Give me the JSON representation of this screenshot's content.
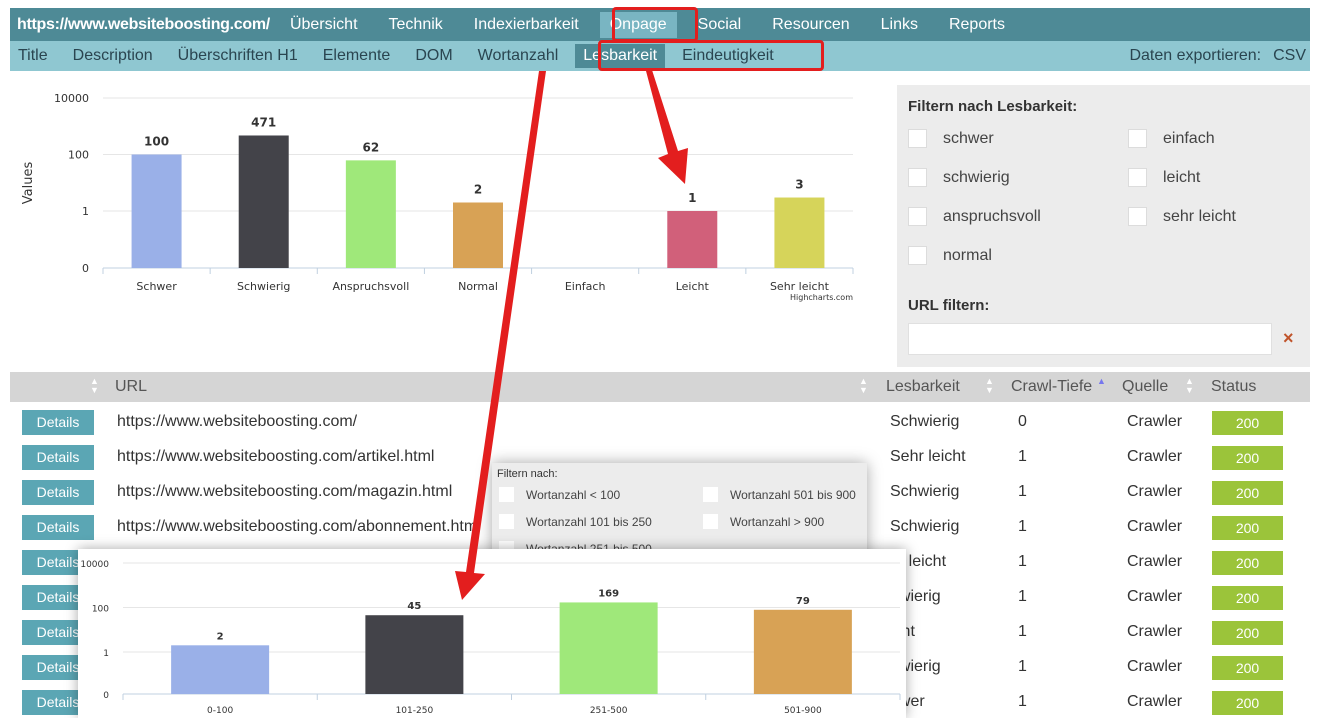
{
  "topnav": {
    "site": "https://www.websiteboosting.com/",
    "items": [
      "Übersicht",
      "Technik",
      "Indexierbarkeit",
      "Onpage",
      "Social",
      "Resourcen",
      "Links",
      "Reports"
    ],
    "active": "Onpage"
  },
  "subnav": {
    "items": [
      "Title",
      "Description",
      "Überschriften H1",
      "Elemente",
      "DOM",
      "Wortanzahl",
      "Lesbarkeit",
      "Eindeutigkeit"
    ],
    "active": "Lesbarkeit",
    "export_label": "Daten exportieren:",
    "export_csv": "CSV"
  },
  "filter": {
    "title": "Filtern nach Lesbarkeit:",
    "options": [
      "schwer",
      "einfach",
      "schwierig",
      "leicht",
      "anspruchsvoll",
      "sehr leicht",
      "normal"
    ],
    "url_title": "URL filtern:",
    "url_value": "",
    "clear_icon": "×"
  },
  "table": {
    "columns": [
      "URL",
      "Lesbarkeit",
      "Crawl-Tiefe",
      "Quelle",
      "Status"
    ],
    "details_label": "Details",
    "rows": [
      {
        "url": "https://www.websiteboosting.com/",
        "lesbarkeit": "Schwierig",
        "tiefe": "0",
        "quelle": "Crawler",
        "status": "200"
      },
      {
        "url": "https://www.websiteboosting.com/artikel.html",
        "lesbarkeit": "Sehr leicht",
        "tiefe": "1",
        "quelle": "Crawler",
        "status": "200"
      },
      {
        "url": "https://www.websiteboosting.com/magazin.html",
        "lesbarkeit": "Schwierig",
        "tiefe": "1",
        "quelle": "Crawler",
        "status": "200"
      },
      {
        "url": "https://www.websiteboosting.com/abonnement.htm",
        "lesbarkeit": "Schwierig",
        "tiefe": "1",
        "quelle": "Crawler",
        "status": "200"
      },
      {
        "url": "",
        "lesbarkeit": "hr leicht",
        "tiefe": "1",
        "quelle": "Crawler",
        "status": "200"
      },
      {
        "url": "",
        "lesbarkeit": "hwierig",
        "tiefe": "1",
        "quelle": "Crawler",
        "status": "200"
      },
      {
        "url": "",
        "lesbarkeit": "icht",
        "tiefe": "1",
        "quelle": "Crawler",
        "status": "200"
      },
      {
        "url": "",
        "lesbarkeit": "hwierig",
        "tiefe": "1",
        "quelle": "Crawler",
        "status": "200"
      },
      {
        "url": "",
        "lesbarkeit": "hwer",
        "tiefe": "1",
        "quelle": "Crawler",
        "status": "200"
      }
    ]
  },
  "popup": {
    "title": "Filtern nach:",
    "options": [
      "Wortanzahl < 100",
      "Wortanzahl 501 bis 900",
      "Wortanzahl 101 bis 250",
      "Wortanzahl > 900",
      "Wortanzahl 251 bis 500"
    ]
  },
  "colors": {
    "accent_dark": "#4e8a96",
    "accent_light": "#8fc7d1",
    "status_ok": "#9bc43a",
    "highlight": "#e31e1e"
  },
  "chart_data": [
    {
      "type": "bar",
      "ylabel": "Values",
      "yscale": "log",
      "yticks": [
        "0",
        "1",
        "100",
        "10000"
      ],
      "categories": [
        "Schwer",
        "Schwierig",
        "Anspruchsvoll",
        "Normal",
        "Einfach",
        "Leicht",
        "Sehr leicht"
      ],
      "values": [
        100,
        471,
        62,
        2,
        null,
        1,
        3
      ],
      "labels": [
        "100",
        "471",
        "62",
        "2",
        "",
        "1",
        "3"
      ],
      "colors": [
        "#9ab0e8",
        "#434349",
        "#9fe87a",
        "#d8a255",
        "#ffffff",
        "#d1607a",
        "#d6d45a"
      ],
      "credit": "Highcharts.com"
    },
    {
      "type": "bar",
      "yscale": "log",
      "yticks": [
        "0",
        "1",
        "100",
        "10000"
      ],
      "categories": [
        "0-100",
        "101-250",
        "251-500",
        "501-900"
      ],
      "values": [
        2,
        45,
        169,
        79
      ],
      "labels": [
        "2",
        "45",
        "169",
        "79"
      ],
      "colors": [
        "#9ab0e8",
        "#434349",
        "#9fe87a",
        "#d8a255"
      ]
    }
  ]
}
